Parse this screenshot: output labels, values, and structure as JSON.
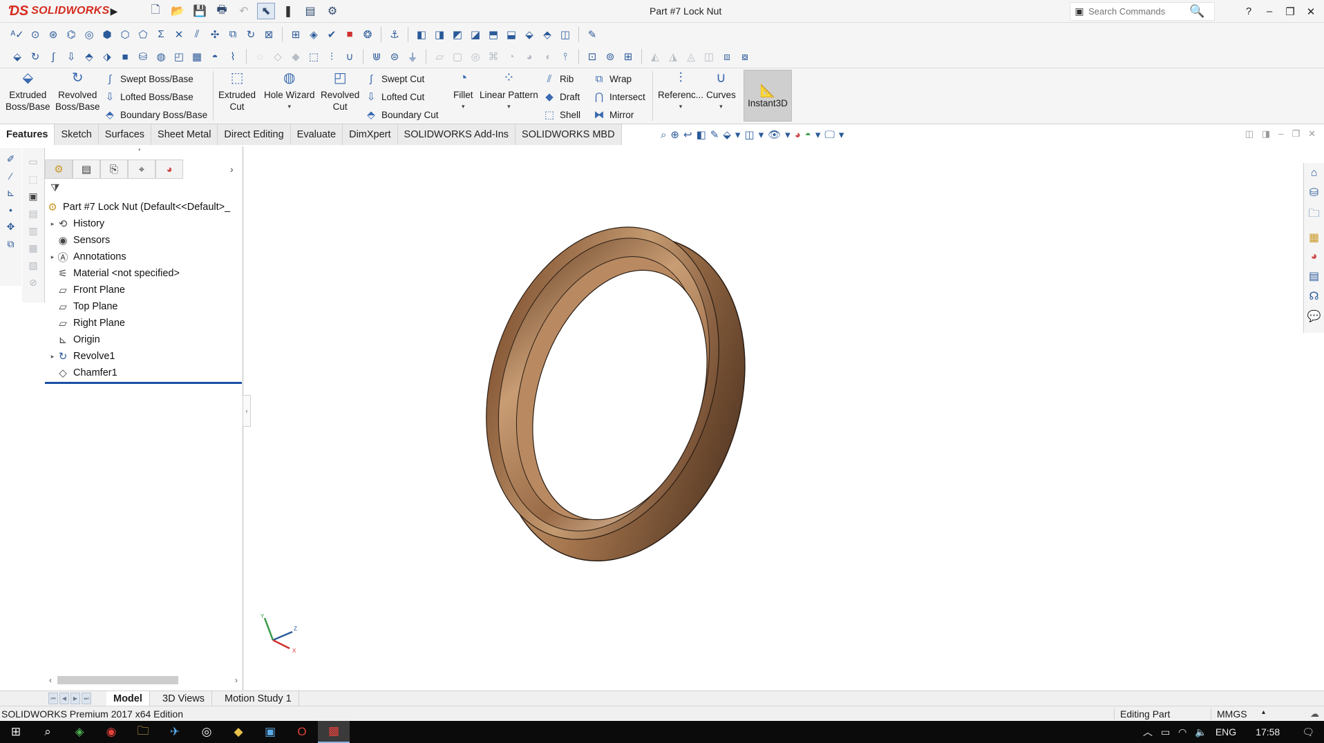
{
  "app": {
    "brand": "SOLIDWORKS",
    "document_title": "Part #7 Lock Nut",
    "search_placeholder": "Search Commands",
    "accent_color": "#d52b1e"
  },
  "command_manager": {
    "extruded_boss": [
      "Extruded",
      "Boss/Base"
    ],
    "revolved_boss": [
      "Revolved",
      "Boss/Base"
    ],
    "swept_boss": "Swept Boss/Base",
    "lofted_boss": "Lofted Boss/Base",
    "boundary_boss": "Boundary Boss/Base",
    "extruded_cut": [
      "Extruded",
      "Cut"
    ],
    "hole_wizard": "Hole Wizard",
    "revolved_cut": [
      "Revolved",
      "Cut"
    ],
    "swept_cut": "Swept Cut",
    "lofted_cut": "Lofted Cut",
    "boundary_cut": "Boundary Cut",
    "fillet": "Fillet",
    "linear_pattern": "Linear Pattern",
    "rib": "Rib",
    "draft": "Draft",
    "shell": "Shell",
    "wrap": "Wrap",
    "intersect": "Intersect",
    "mirror": "Mirror",
    "reference": "Referenc...",
    "curves": "Curves",
    "instant3d": "Instant3D"
  },
  "tabs": [
    "Features",
    "Sketch",
    "Surfaces",
    "Sheet Metal",
    "Direct Editing",
    "Evaluate",
    "DimXpert",
    "SOLIDWORKS Add-Ins",
    "SOLIDWORKS MBD"
  ],
  "active_tab": "Features",
  "feature_tree": {
    "root": "Part #7 Lock Nut  (Default<<Default>_",
    "items": [
      {
        "label": "History",
        "expandable": true,
        "icon": "history-icon"
      },
      {
        "label": "Sensors",
        "expandable": false,
        "icon": "sensors-icon"
      },
      {
        "label": "Annotations",
        "expandable": true,
        "icon": "annotations-icon"
      },
      {
        "label": "Material <not specified>",
        "expandable": false,
        "icon": "material-icon"
      },
      {
        "label": "Front Plane",
        "expandable": false,
        "icon": "plane-icon"
      },
      {
        "label": "Top Plane",
        "expandable": false,
        "icon": "plane-icon"
      },
      {
        "label": "Right Plane",
        "expandable": false,
        "icon": "plane-icon"
      },
      {
        "label": "Origin",
        "expandable": false,
        "icon": "origin-icon"
      },
      {
        "label": "Revolve1",
        "expandable": true,
        "icon": "revolve-icon"
      },
      {
        "label": "Chamfer1",
        "expandable": false,
        "icon": "chamfer-icon"
      }
    ]
  },
  "model_tabs": [
    "Model",
    "3D Views",
    "Motion Study 1"
  ],
  "active_model_tab": "Model",
  "status": {
    "edition": "SOLIDWORKS Premium 2017 x64 Edition",
    "mode": "Editing Part",
    "units": "MMGS"
  },
  "taskbar": {
    "language": "ENG",
    "time": "17:58"
  },
  "model": {
    "shape": "ring",
    "color": "#a8784f"
  }
}
